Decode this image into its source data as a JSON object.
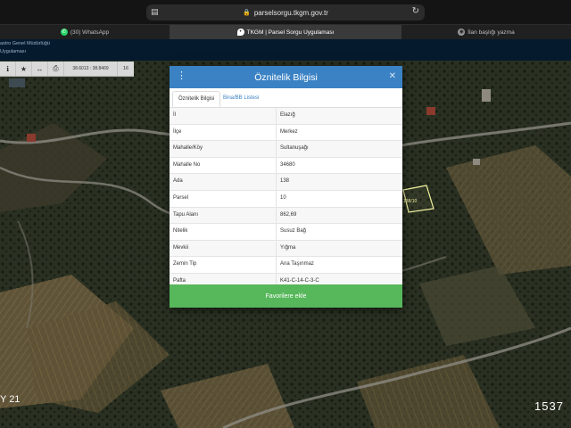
{
  "browser": {
    "url": "parselsorgu.tkgm.gov.tr",
    "tabs": [
      {
        "label": "(30) WhatsApp"
      },
      {
        "label": "TKGM | Parsel Sorgu Uygulaması"
      },
      {
        "label": "İlan başlığı yazma"
      }
    ]
  },
  "app_header": {
    "line1": "astro Genel Müdürlüğü",
    "line2": "Uygulaması"
  },
  "map_toolbar": {
    "coords": "38.6013 : 38.8469",
    "zoom": "16"
  },
  "map": {
    "parcel_label": "138/10",
    "watermark_left": "Y 21",
    "watermark_right": "1537"
  },
  "modal": {
    "title": "Öznitelik Bilgisi",
    "tabs": [
      "Öznitelik Bilgisi",
      "Bina/BB Listesi"
    ],
    "rows": [
      {
        "key": "İl",
        "value": "Elazığ"
      },
      {
        "key": "İlçe",
        "value": "Merkez"
      },
      {
        "key": "Mahalle/Köy",
        "value": "Sultanuşağı"
      },
      {
        "key": "Mahalle No",
        "value": "34680"
      },
      {
        "key": "Ada",
        "value": "138"
      },
      {
        "key": "Parsel",
        "value": "10"
      },
      {
        "key": "Tapu Alanı",
        "value": "862,69"
      },
      {
        "key": "Nitelik",
        "value": "Susuz Bağ"
      },
      {
        "key": "Mevkii",
        "value": "Yığma"
      },
      {
        "key": "Zemin Tip",
        "value": "Ana Taşınmaz"
      },
      {
        "key": "Pafta",
        "value": "K41-C-14-C-3-C"
      }
    ],
    "button": "Favorilere ekle"
  },
  "colors": {
    "header_blue": "#3b82c4",
    "button_green": "#57b75b",
    "app_header_bg": "#061a2e"
  }
}
